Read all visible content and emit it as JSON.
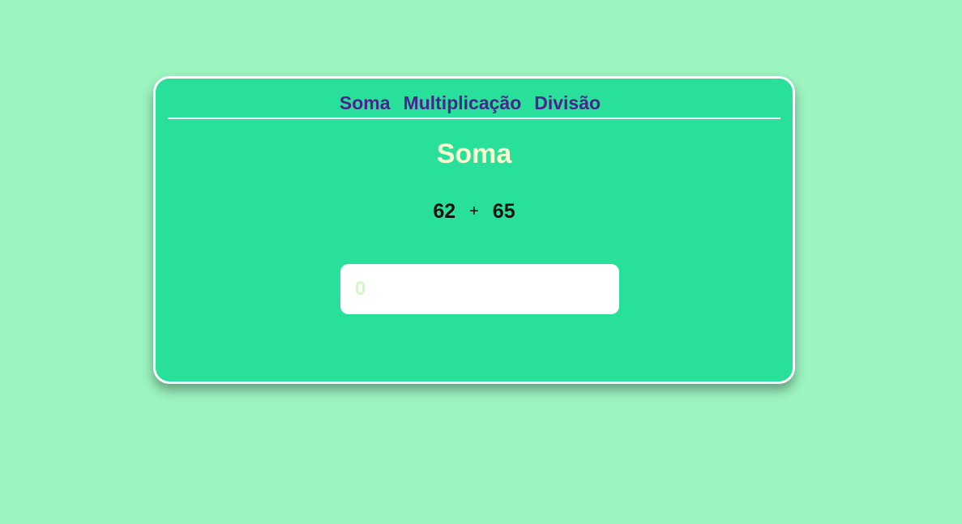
{
  "nav": {
    "items": [
      {
        "label": "Soma"
      },
      {
        "label": "Multiplicação"
      },
      {
        "label": "Divisão"
      }
    ]
  },
  "main": {
    "title": "Soma",
    "problem": {
      "operand_a": "62",
      "operator": "+",
      "operand_b": "65"
    },
    "answer": {
      "value": "",
      "placeholder": "0"
    }
  },
  "colors": {
    "background": "#9cf4c0",
    "card": "#28e09a",
    "nav_text": "#4b2390",
    "title_text": "#fbffd0"
  }
}
